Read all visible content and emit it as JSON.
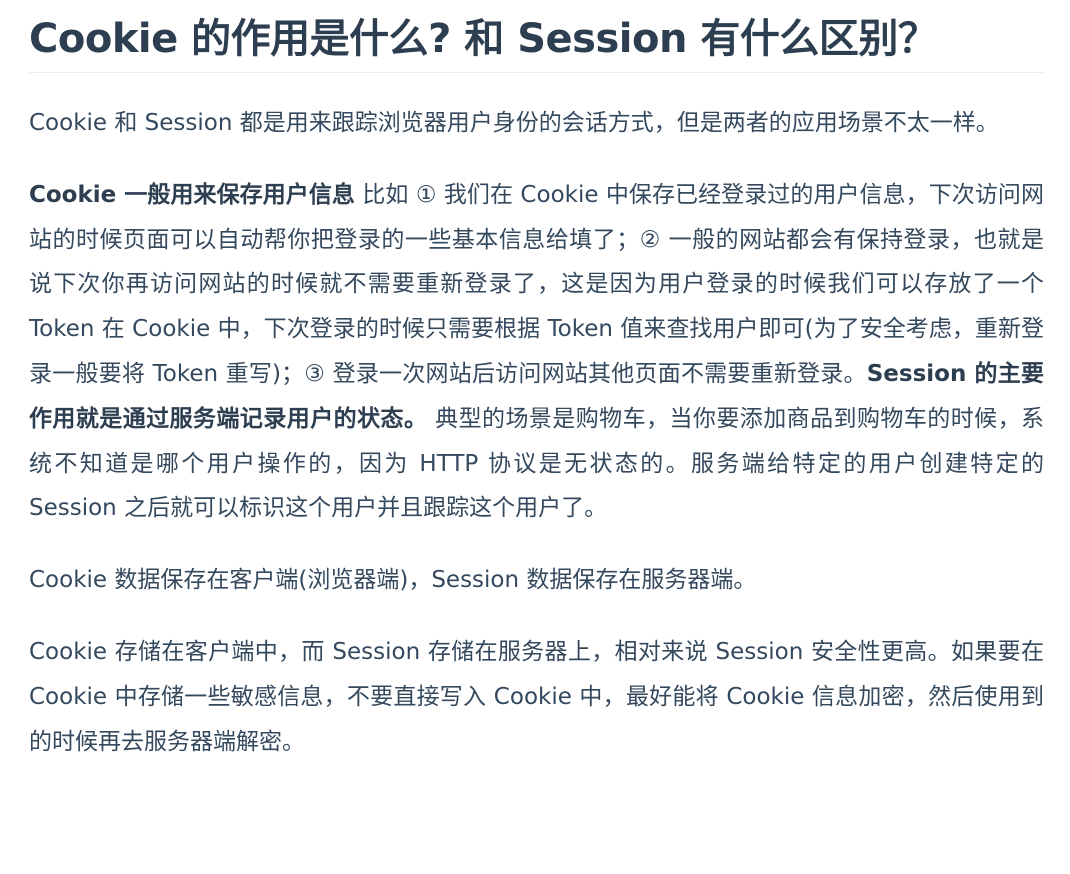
{
  "article": {
    "title": "Cookie 的作用是什么? 和 Session 有什么区别？",
    "paragraphs": [
      {
        "id": "p1",
        "segments": [
          {
            "text": "Cookie 和 Session 都是用来跟踪浏览器用户身份的会话方式，但是两者的应用场景不太一样。",
            "bold": false
          }
        ]
      },
      {
        "id": "p2",
        "segments": [
          {
            "text": "Cookie 一般用来保存用户信息",
            "bold": true
          },
          {
            "text": " 比如 ① 我们在 Cookie 中保存已经登录过的用户信息，下次访问网站的时候页面可以自动帮你把登录的一些基本信息给填了；② 一般的网站都会有保持登录，也就是说下次你再访问网站的时候就不需要重新登录了，这是因为用户登录的时候我们可以存放了一个 Token 在 Cookie 中，下次登录的时候只需要根据 Token 值来查找用户即可(为了安全考虑，重新登录一般要将 Token 重写)；③ 登录一次网站后访问网站其他页面不需要重新登录。",
            "bold": false
          },
          {
            "text": "Session 的主要作用就是通过服务端记录用户的状态。",
            "bold": true
          },
          {
            "text": " 典型的场景是购物车，当你要添加商品到购物车的时候，系统不知道是哪个用户操作的，因为 HTTP 协议是无状态的。服务端给特定的用户创建特定的 Session 之后就可以标识这个用户并且跟踪这个用户了。",
            "bold": false
          }
        ]
      },
      {
        "id": "p3",
        "segments": [
          {
            "text": "Cookie 数据保存在客户端(浏览器端)，Session 数据保存在服务器端。",
            "bold": false
          }
        ]
      },
      {
        "id": "p4",
        "segments": [
          {
            "text": "Cookie 存储在客户端中，而 Session 存储在服务器上，相对来说 Session 安全性更高。如果要在 Cookie 中存储一些敏感信息，不要直接写入 Cookie 中，最好能将 Cookie 信息加密，然后使用到的时候再去服务器端解密。",
            "bold": false
          }
        ]
      }
    ]
  }
}
